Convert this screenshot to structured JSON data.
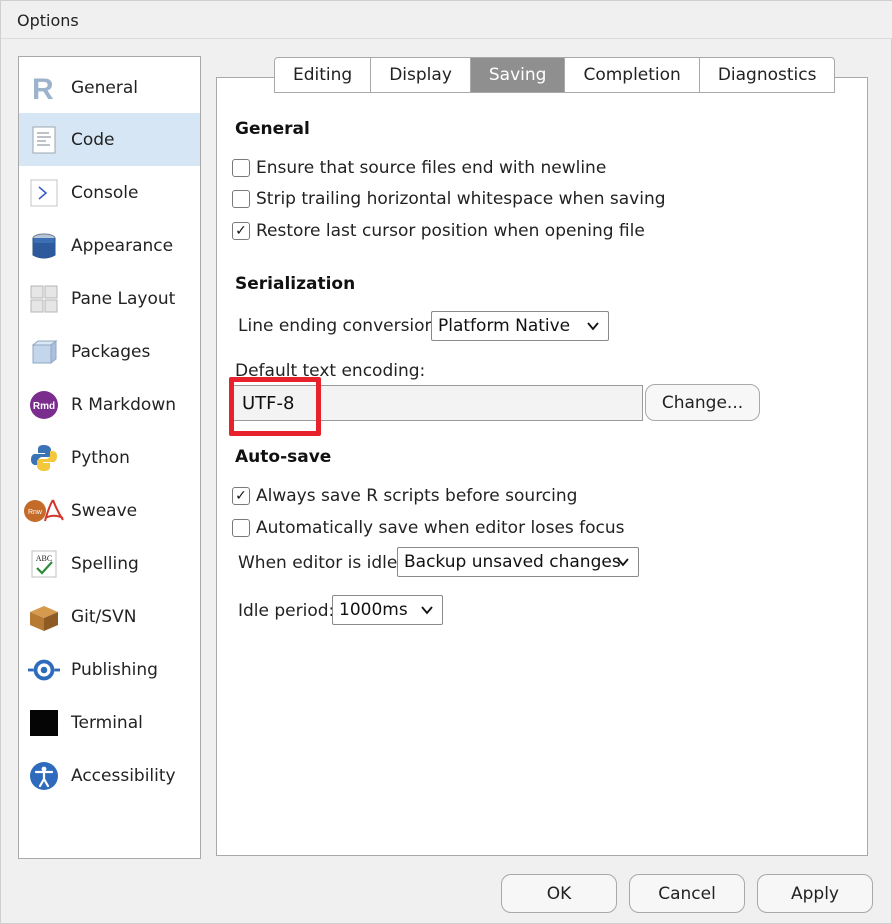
{
  "window": {
    "title": "Options"
  },
  "sidebar": {
    "items": [
      {
        "label": "General",
        "icon": "r-logo-icon"
      },
      {
        "label": "Code",
        "icon": "code-document-icon"
      },
      {
        "label": "Console",
        "icon": "console-prompt-icon"
      },
      {
        "label": "Appearance",
        "icon": "paint-bucket-icon"
      },
      {
        "label": "Pane Layout",
        "icon": "pane-grid-icon"
      },
      {
        "label": "Packages",
        "icon": "package-box-icon"
      },
      {
        "label": "R Markdown",
        "icon": "rmd-icon"
      },
      {
        "label": "Python",
        "icon": "python-icon"
      },
      {
        "label": "Sweave",
        "icon": "sweave-pdf-icon"
      },
      {
        "label": "Spelling",
        "icon": "spelling-check-icon"
      },
      {
        "label": "Git/SVN",
        "icon": "git-box-icon"
      },
      {
        "label": "Publishing",
        "icon": "publishing-icon"
      },
      {
        "label": "Terminal",
        "icon": "terminal-icon"
      },
      {
        "label": "Accessibility",
        "icon": "accessibility-icon"
      }
    ],
    "active": "Code"
  },
  "tabs": [
    "Editing",
    "Display",
    "Saving",
    "Completion",
    "Diagnostics"
  ],
  "active_tab": "Saving",
  "general": {
    "title": "General",
    "ensure_newline": {
      "label": "Ensure that source files end with newline",
      "checked": false
    },
    "strip_whitespace": {
      "label": "Strip trailing horizontal whitespace when saving",
      "checked": false
    },
    "restore_cursor": {
      "label": "Restore last cursor position when opening file",
      "checked": true
    }
  },
  "serialization": {
    "title": "Serialization",
    "line_ending_label": "Line ending conversion:",
    "line_ending_value": "Platform Native",
    "encoding_label": "Default text encoding:",
    "encoding_value": "UTF-8",
    "change_button": "Change..."
  },
  "autosave": {
    "title": "Auto-save",
    "always_save": {
      "label": "Always save R scripts before sourcing",
      "checked": true
    },
    "auto_save_focus": {
      "label": "Automatically save when editor loses focus",
      "checked": false
    },
    "idle_label": "When editor is idle:",
    "idle_value": "Backup unsaved changes",
    "idle_period_label": "Idle period:",
    "idle_period_value": "1000ms"
  },
  "footer": {
    "ok": "OK",
    "cancel": "Cancel",
    "apply": "Apply"
  },
  "colors": {
    "highlight": "#e8222d",
    "active_item": "#d6e6f5",
    "active_tab": "#8f8f8f"
  },
  "check_glyph": "✓"
}
